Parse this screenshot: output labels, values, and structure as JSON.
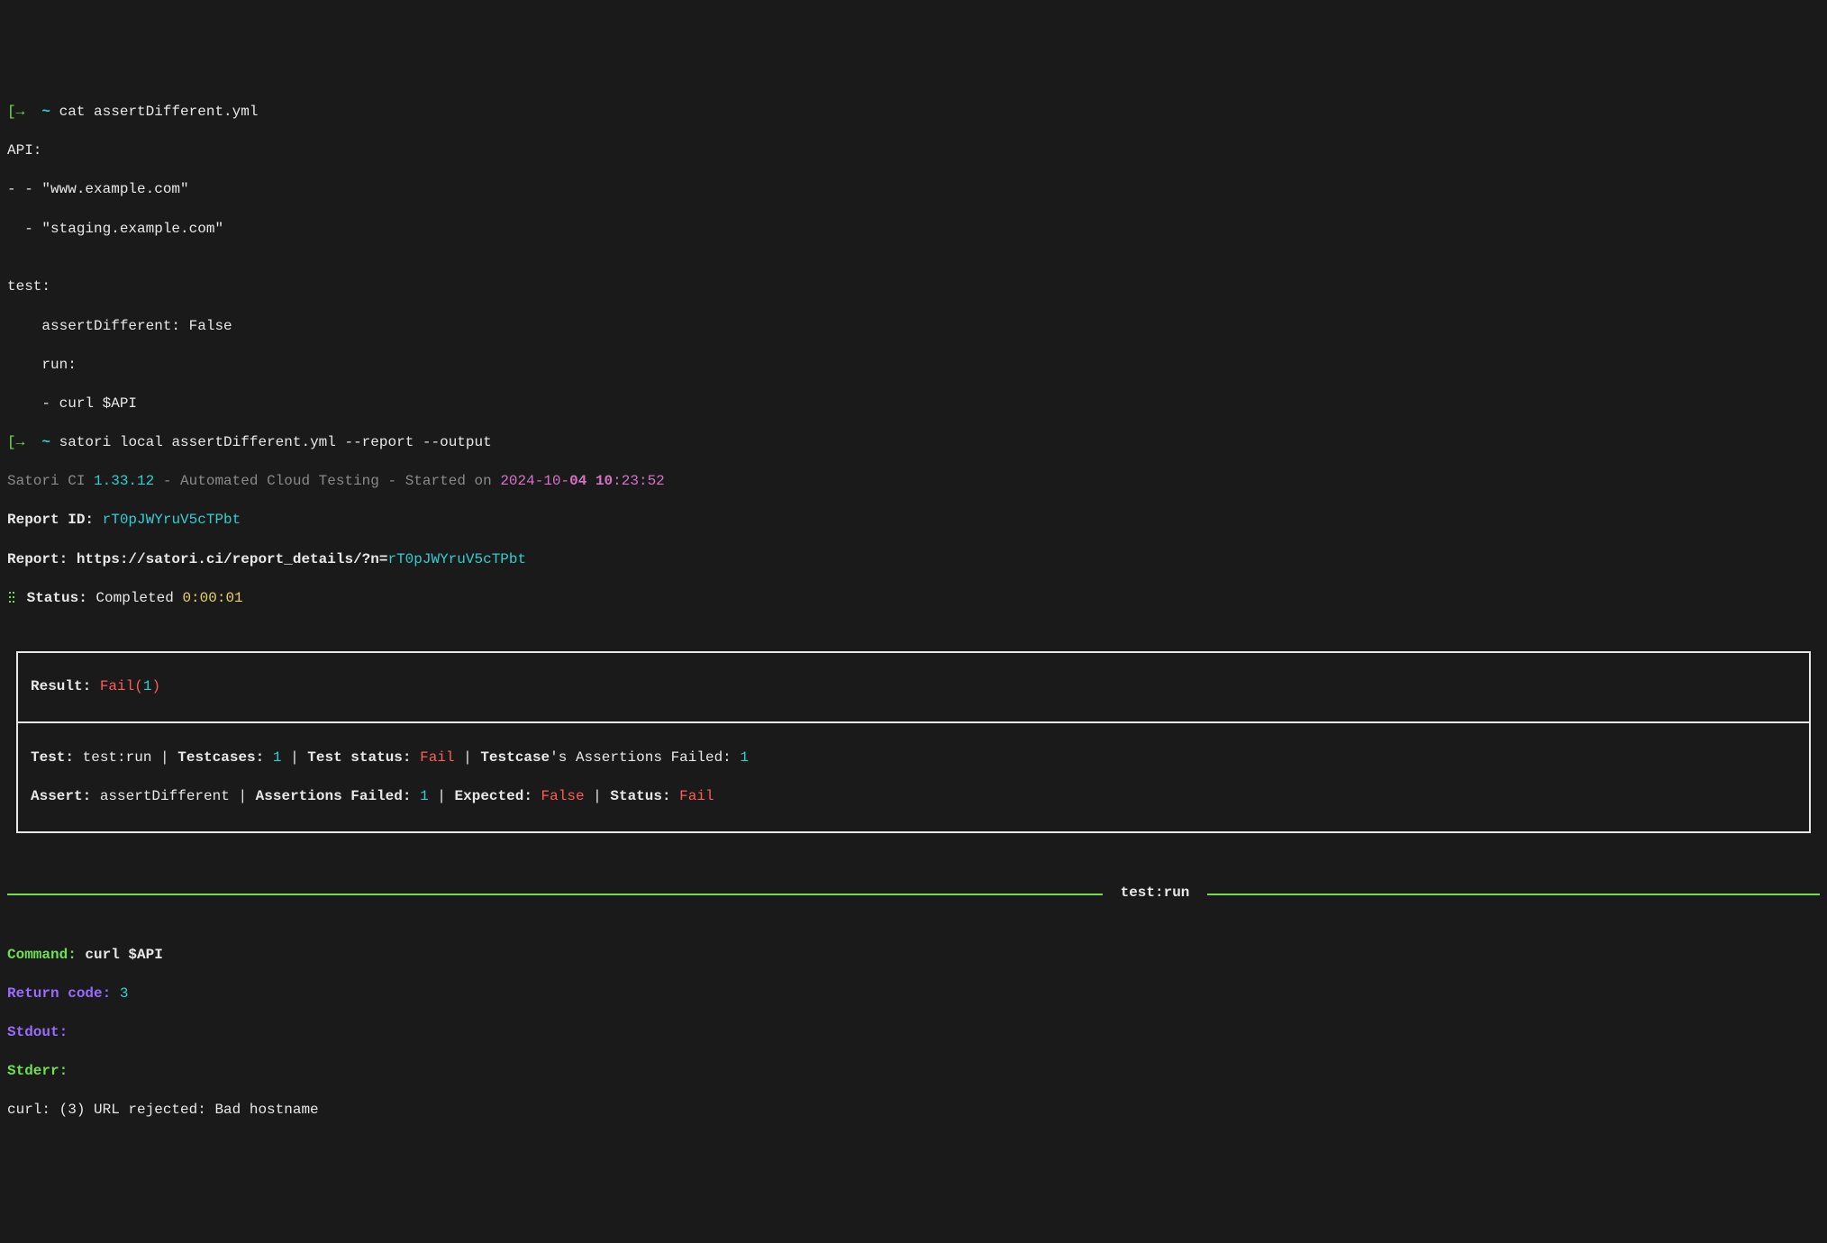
{
  "prompt": {
    "open": "[→",
    "cwd": "~",
    "close": "]"
  },
  "cmd1": {
    "text": "cat assertDifferent.yml"
  },
  "yml": {
    "l1": "API:",
    "l2": "- - \"www.example.com\"",
    "l3": "  - \"staging.example.com\"",
    "l4": "",
    "l5": "test:",
    "l6": "    assertDifferent: False",
    "l7": "    run:",
    "l8": "    - curl $API"
  },
  "cmd2": {
    "text": "satori local assertDifferent.yml --report --output"
  },
  "banner": {
    "product": "Satori CI ",
    "version": "1.33.12",
    "sep": " - ",
    "desc": "Automated Cloud Testing",
    "started_label": "Started on ",
    "started_date": "2024-10-",
    "started_day": "04",
    "started_time_h": " 10",
    "started_time_rest": ":23:52"
  },
  "report": {
    "id_label": "Report ID: ",
    "id_value": "rT0pJWYruV5cTPbt",
    "url_label": "Report: ",
    "url_prefix": "https://satori.ci/report_details/?n=",
    "url_n": "rT0pJWYruV5cTPbt"
  },
  "status": {
    "label": " Status: ",
    "value": "Completed ",
    "time": "0:00:01"
  },
  "result": {
    "label": "Result: ",
    "value": "Fail",
    "open": "(",
    "count": "1",
    "close": ")"
  },
  "test": {
    "label": "Test: ",
    "name": "test:run",
    "sep": " | ",
    "tc_label": "Testcases: ",
    "tc_count": "1",
    "ts_label": "Test status: ",
    "ts_value": "Fail",
    "tcaf_label_1": "Testcase",
    "tcaf_label_2": "'s Assertions Failed: ",
    "tcaf_count": "1"
  },
  "assert": {
    "label": "Assert: ",
    "name": "assertDifferent",
    "sep": " | ",
    "af_label": "Assertions Failed: ",
    "af_count": "1",
    "exp_label": "Expected: ",
    "exp_value": "False",
    "st_label": "Status: ",
    "st_value": "Fail"
  },
  "hr": {
    "label": " test:run "
  },
  "output": {
    "cmd_label": "Command: ",
    "cmd_value": "curl $API",
    "rc_label": "Return code: ",
    "rc_value": "3",
    "stdout_label": "Stdout:",
    "stderr_label": "Stderr:",
    "stderr_line": "curl: (3) URL rejected: Bad hostname"
  }
}
